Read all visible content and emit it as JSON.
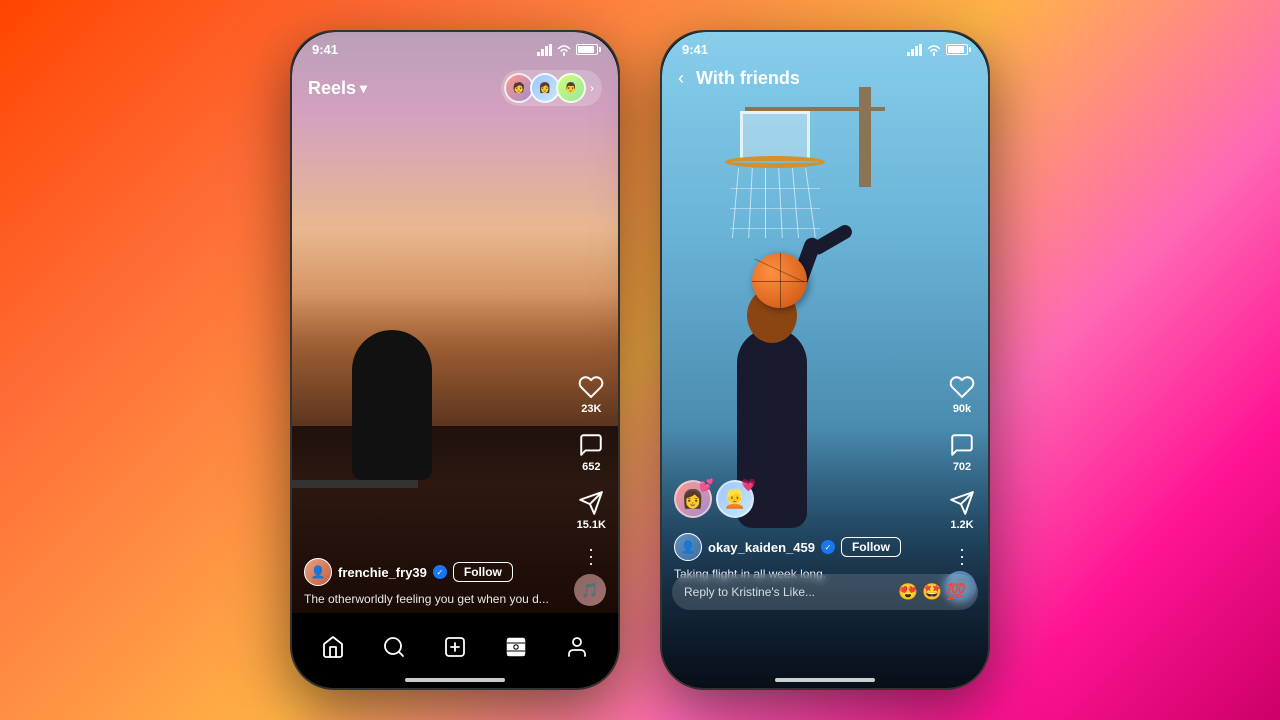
{
  "background": {
    "gradient": "linear-gradient(135deg, #ff4500, #ff6b35, #ff8c42, #ffb347, #ff69b4, #ff1493, #cc0066)"
  },
  "phone1": {
    "status": {
      "time": "9:41",
      "signal": "●●●",
      "wifi": "wifi",
      "battery": "battery"
    },
    "header": {
      "title": "Reels",
      "chevron": "▾"
    },
    "actions": {
      "likes": "23K",
      "comments": "652",
      "shares": "15.1K"
    },
    "user": {
      "name": "frenchie_fry39",
      "verified": "✓",
      "follow_label": "Follow",
      "caption": "The otherworldly feeling you get when you d..."
    },
    "nav": {
      "home": "⌂",
      "search": "◯",
      "add": "+",
      "reels": "▶",
      "profile": "◯"
    }
  },
  "phone2": {
    "status": {
      "time": "9:41",
      "signal": "●●●",
      "wifi": "wifi",
      "battery": "battery"
    },
    "header": {
      "back": "‹",
      "title": "With friends"
    },
    "actions": {
      "likes": "90k",
      "comments": "702",
      "shares": "1.2K"
    },
    "user": {
      "name": "okay_kaiden_459",
      "verified": "✓",
      "follow_label": "Follow",
      "caption": "Taking flight in all week long."
    },
    "reply": {
      "placeholder": "Reply to Kristine's Like...",
      "emoji1": "😍",
      "emoji2": "🤩",
      "emoji3": "💯"
    }
  }
}
